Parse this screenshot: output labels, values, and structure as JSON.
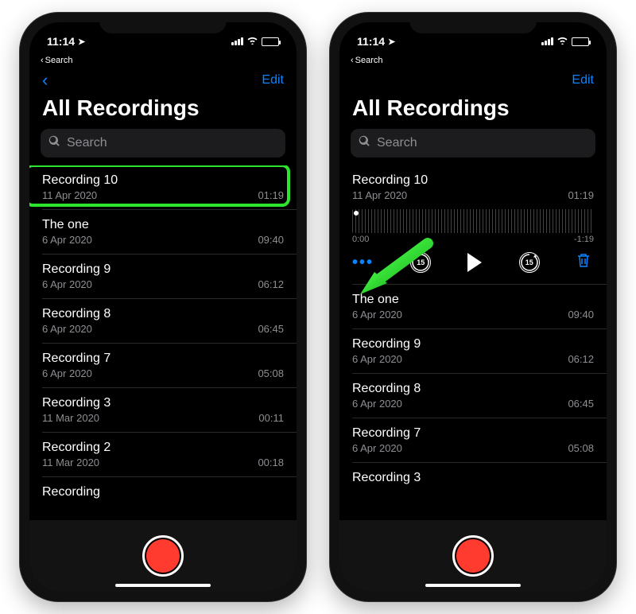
{
  "status": {
    "time": "11:14",
    "back_label": "Search"
  },
  "colors": {
    "accent": "#0a84ff",
    "record": "#ff3b30",
    "highlight": "#2ee52e"
  },
  "nav": {
    "edit": "Edit"
  },
  "title": "All Recordings",
  "search": {
    "placeholder": "Search"
  },
  "left_screen": {
    "rows": [
      {
        "name": "Recording 10",
        "date": "11 Apr 2020",
        "duration": "01:19"
      },
      {
        "name": "The one",
        "date": "6 Apr 2020",
        "duration": "09:40"
      },
      {
        "name": "Recording 9",
        "date": "6 Apr 2020",
        "duration": "06:12"
      },
      {
        "name": "Recording 8",
        "date": "6 Apr 2020",
        "duration": "06:45"
      },
      {
        "name": "Recording 7",
        "date": "6 Apr 2020",
        "duration": "05:08"
      },
      {
        "name": "Recording 3",
        "date": "11 Mar 2020",
        "duration": "00:11"
      },
      {
        "name": "Recording 2",
        "date": "11 Mar 2020",
        "duration": "00:18"
      },
      {
        "name": "Recording",
        "date": "",
        "duration": ""
      }
    ]
  },
  "right_screen": {
    "expanded": {
      "name": "Recording 10",
      "date": "11 Apr 2020",
      "duration": "01:19",
      "elapsed": "0:00",
      "remaining": "-1:19",
      "skip_amount": "15"
    },
    "rows": [
      {
        "name": "The one",
        "date": "6 Apr 2020",
        "duration": "09:40"
      },
      {
        "name": "Recording 9",
        "date": "6 Apr 2020",
        "duration": "06:12"
      },
      {
        "name": "Recording 8",
        "date": "6 Apr 2020",
        "duration": "06:45"
      },
      {
        "name": "Recording 7",
        "date": "6 Apr 2020",
        "duration": "05:08"
      },
      {
        "name": "Recording 3",
        "date": "",
        "duration": ""
      }
    ]
  }
}
